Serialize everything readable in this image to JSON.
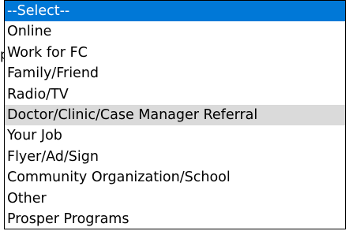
{
  "select": {
    "hovered_index": 5,
    "selected_index": 0,
    "options": [
      "--Select--",
      "Online",
      "Work for FC",
      "Family/Friend",
      "Radio/TV",
      "Doctor/Clinic/Case Manager Referral",
      "Your Job",
      "Flyer/Ad/Sign",
      "Community Organization/School",
      "Other",
      "Prosper Programs"
    ]
  },
  "colors": {
    "selected_bg": "#0078d7",
    "hover_bg": "#dadada"
  }
}
